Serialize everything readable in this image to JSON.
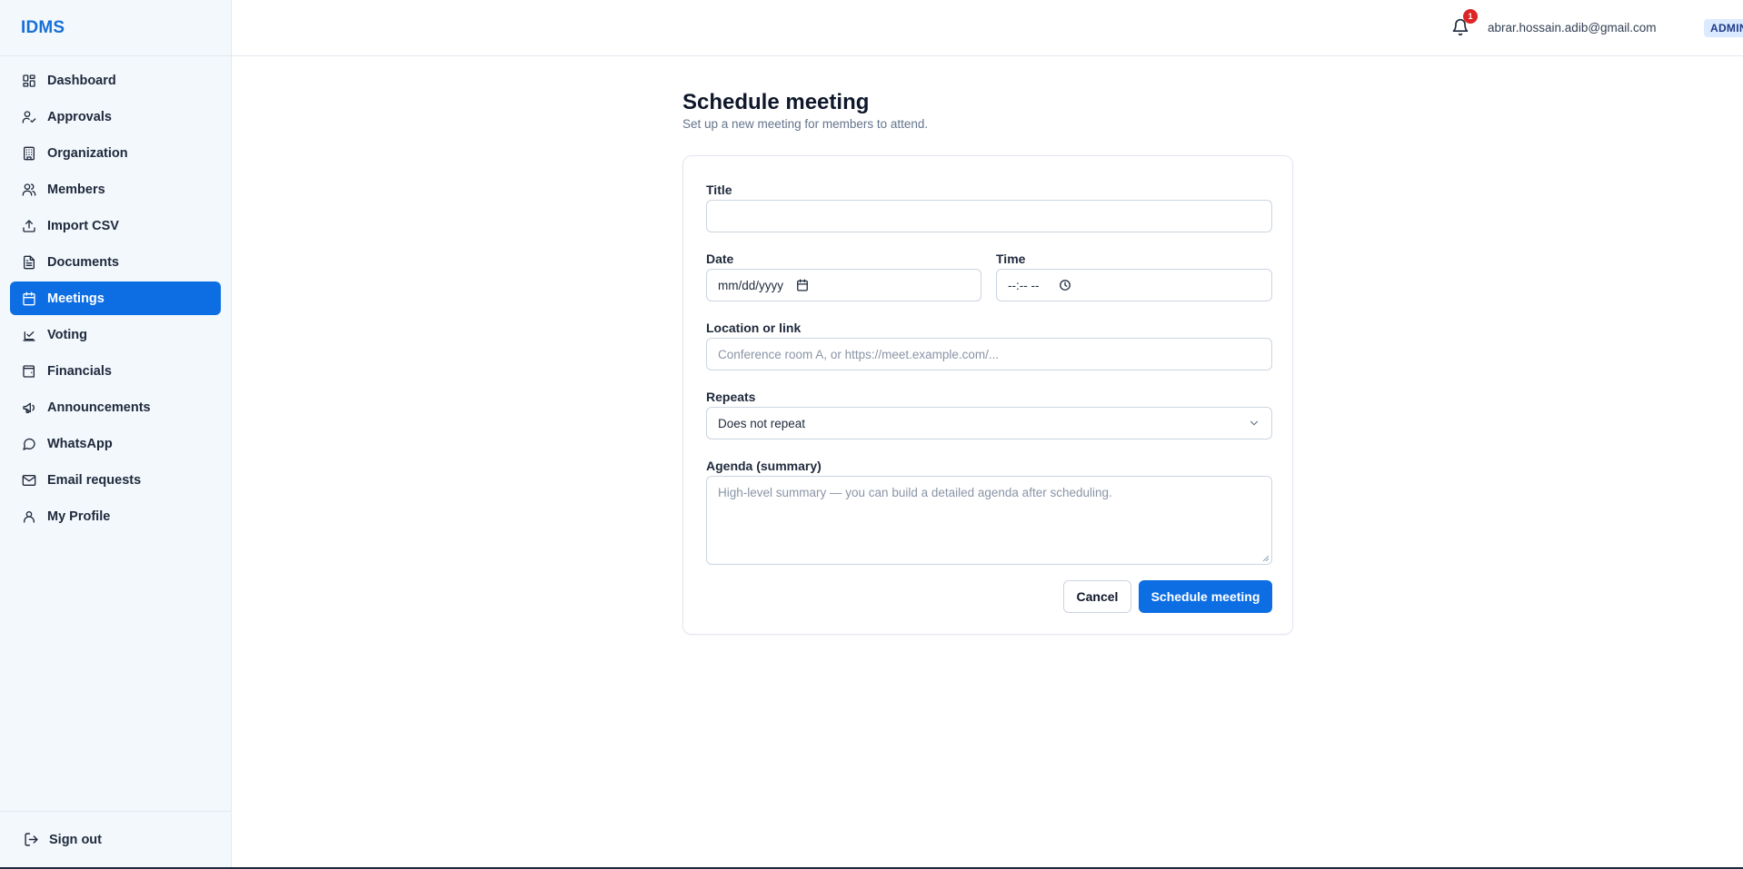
{
  "app": {
    "brand": "IDMS"
  },
  "sidebar": {
    "items": [
      {
        "label": "Dashboard",
        "icon": "dashboard-icon",
        "active": false
      },
      {
        "label": "Approvals",
        "icon": "user-check-icon",
        "active": false
      },
      {
        "label": "Organization",
        "icon": "building-icon",
        "active": false
      },
      {
        "label": "Members",
        "icon": "users-icon",
        "active": false
      },
      {
        "label": "Import CSV",
        "icon": "upload-icon",
        "active": false
      },
      {
        "label": "Documents",
        "icon": "document-icon",
        "active": false
      },
      {
        "label": "Meetings",
        "icon": "calendar-icon",
        "active": true
      },
      {
        "label": "Voting",
        "icon": "vote-icon",
        "active": false
      },
      {
        "label": "Financials",
        "icon": "wallet-icon",
        "active": false
      },
      {
        "label": "Announcements",
        "icon": "megaphone-icon",
        "active": false
      },
      {
        "label": "WhatsApp",
        "icon": "chat-bubble-icon",
        "active": false
      },
      {
        "label": "Email requests",
        "icon": "mail-icon",
        "active": false
      },
      {
        "label": "My Profile",
        "icon": "user-icon",
        "active": false
      }
    ],
    "signout_label": "Sign out"
  },
  "header": {
    "notification_count": "1",
    "user_email": "abrar.hossain.adib@gmail.com",
    "role": "ADMIN"
  },
  "page": {
    "title": "Schedule meeting",
    "subtitle": "Set up a new meeting for members to attend."
  },
  "form": {
    "title_label": "Title",
    "title_value": "",
    "date_label": "Date",
    "date_placeholder": "mm/dd/yyyy",
    "time_label": "Time",
    "time_placeholder": "--:-- --",
    "location_label": "Location or link",
    "location_placeholder": "Conference room A, or https://meet.example.com/...",
    "repeats_label": "Repeats",
    "repeats_value": "Does not repeat",
    "agenda_label": "Agenda (summary)",
    "agenda_placeholder": "High-level summary — you can build a detailed agenda after scheduling.",
    "cancel_label": "Cancel",
    "submit_label": "Schedule meeting"
  },
  "colors": {
    "accent": "#0d6ee4",
    "brand": "#1670d8",
    "sidebar_bg": "#f3f8fd",
    "badge_red": "#dc2626"
  }
}
